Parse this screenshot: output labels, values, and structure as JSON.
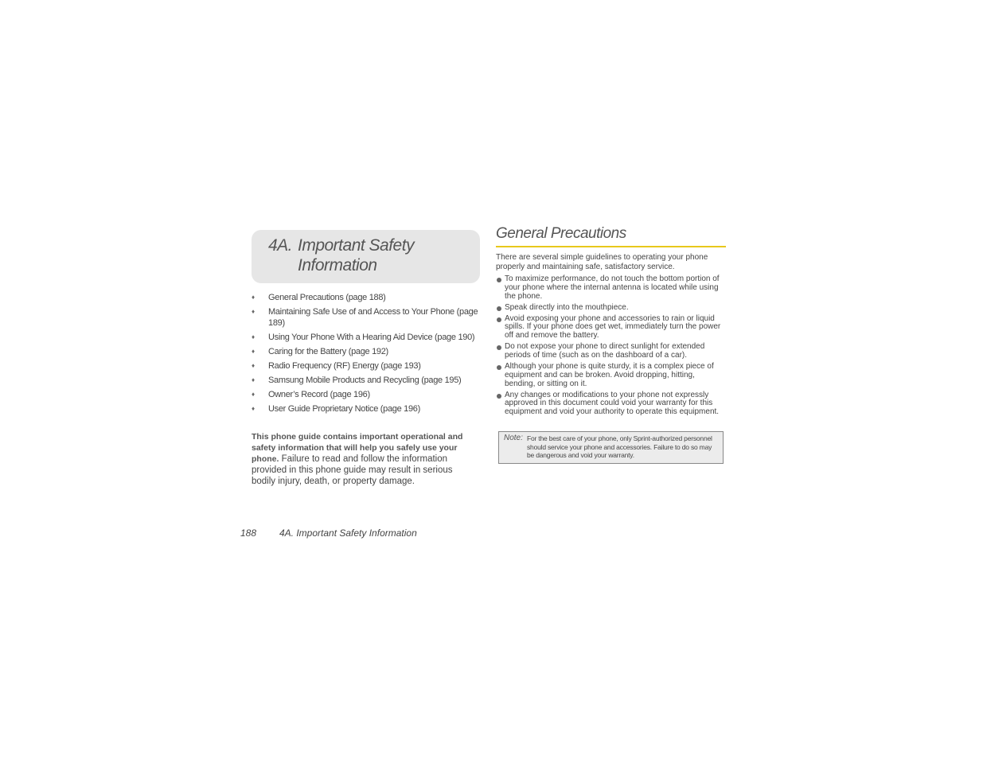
{
  "chapter": {
    "number": "4A.",
    "title_line1": "Important Safety",
    "title_line2": "Information"
  },
  "toc": [
    {
      "label": "General Precautions (page 188)"
    },
    {
      "label": "Maintaining Safe Use of and Access to Your Phone (page 189)"
    },
    {
      "label": "Using Your Phone With a Hearing Aid Device (page 190)"
    },
    {
      "label": "Caring for the Battery (page 192)"
    },
    {
      "label": "Radio Frequency (RF) Energy (page 193)"
    },
    {
      "label": "Samsung Mobile Products and Recycling (page 195)"
    },
    {
      "label": "Owner’s Record (page 196)"
    },
    {
      "label": "User Guide Proprietary Notice (page 196)"
    }
  ],
  "toc_bullet": "♦",
  "intro": {
    "bold": "This phone guide contains important operational and safety information that will help you safely use your phone.",
    "normal": " Failure to read and follow the information provided in this phone guide may result in serious bodily injury, death, or property damage."
  },
  "section": {
    "title": "General Precautions",
    "rule_color": "#e8c81c",
    "intro": "There are several simple guidelines to operating your phone properly and maintaining safe, satisfactory service.",
    "items": [
      {
        "text": "To maximize performance, do not touch the bottom portion of your phone where the internal antenna is located while using the phone."
      },
      {
        "text": "Speak directly into the mouthpiece."
      },
      {
        "text": "Avoid exposing your phone and accessories to rain or liquid spills. If your phone does get wet, immediately turn the power off and remove the battery."
      },
      {
        "text": "Do not expose your phone to direct sunlight for extended periods of time (such as on the dashboard of a car)."
      },
      {
        "text": "Although your phone is quite sturdy, it is a complex piece of equipment and can be broken. Avoid dropping, hitting, bending, or sitting on it."
      },
      {
        "text": "Any changes or modifications to your phone not expressly approved in this document could void your warranty for this equipment and void your authority to operate this equipment."
      }
    ]
  },
  "note": {
    "label": "Note:",
    "text": "For the best care of your phone, only Sprint-authorized personnel should service your phone and accessories. Failure to do so may be dangerous and void your warranty."
  },
  "footer": {
    "page_number": "188",
    "chapter_title": "4A. Important Safety Information"
  }
}
